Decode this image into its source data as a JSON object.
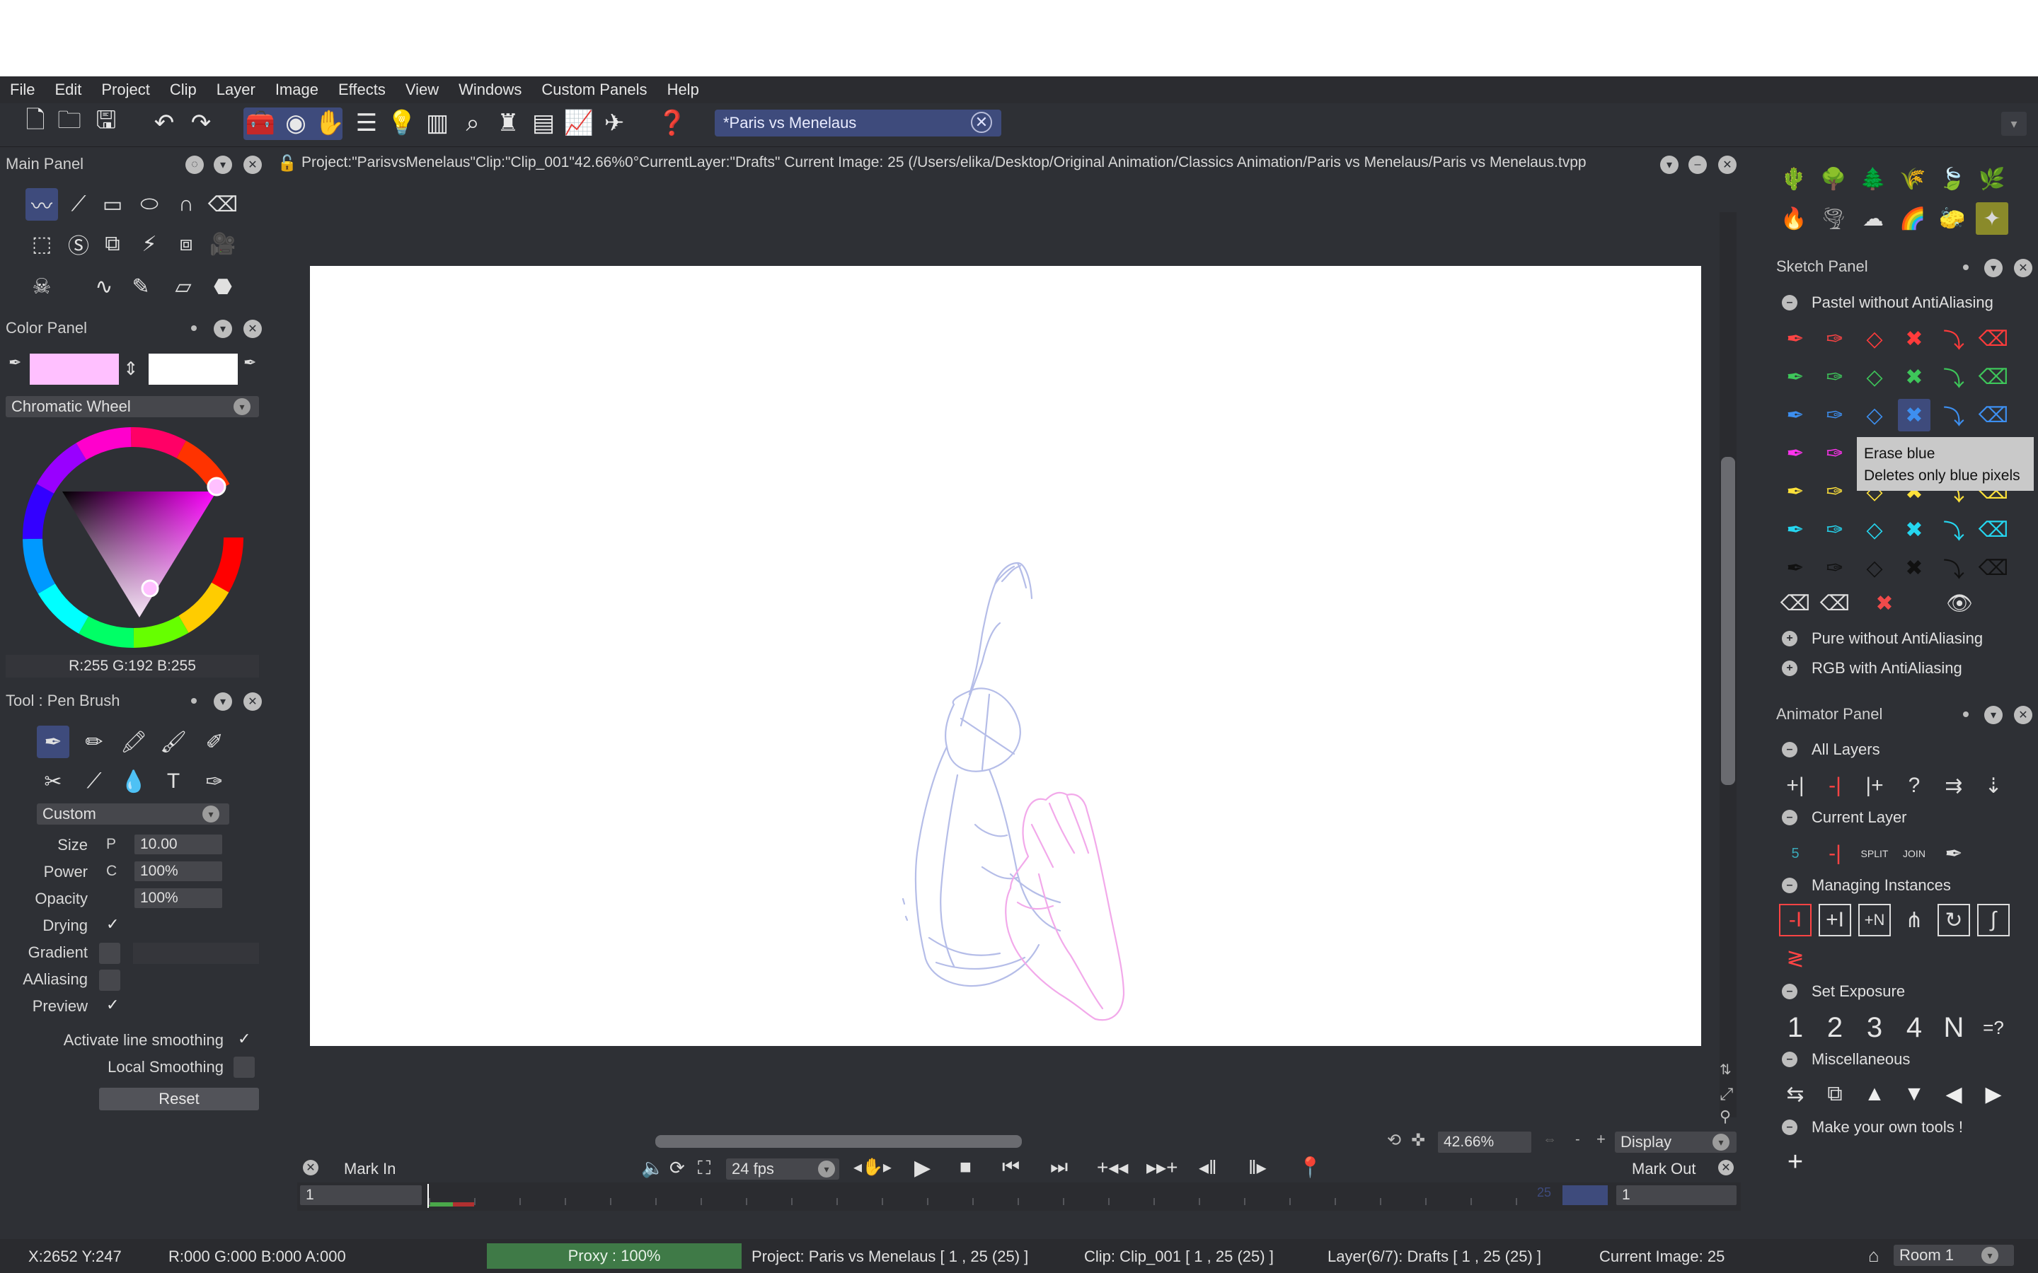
{
  "menu": [
    "File",
    "Edit",
    "Project",
    "Clip",
    "Layer",
    "Image",
    "Effects",
    "View",
    "Windows",
    "Custom Panels",
    "Help"
  ],
  "toolbar": {
    "doc_tab": "*Paris vs Menelaus",
    "close_glyph": "✕",
    "dropdown_glyph": "▾"
  },
  "main_panel": {
    "title": "Main Panel"
  },
  "path_text": "Project:\"ParisvsMenelaus\"Clip:\"Clip_001\"42.66%0°CurrentLayer:\"Drafts\" Current Image: 25 (/Users/elika/Desktop/Original Animation/Classics Animation/Paris vs Menelaus/Paris vs Menelaus.tvpp",
  "color_panel": {
    "title": "Color Panel",
    "mode": "Chromatic Wheel",
    "rgb_readout": "R:255 G:192 B:255",
    "primary_color": "#ffc0ff",
    "secondary_color": "#ffffff"
  },
  "tool_panel": {
    "title": "Tool : Pen Brush",
    "preset": "Custom",
    "size_label": "Size",
    "size_value": "10.00",
    "size_mode": "P",
    "power_label": "Power",
    "power_value": "100%",
    "power_mode": "C",
    "opacity_label": "Opacity",
    "opacity_value": "100%",
    "drying_label": "Drying",
    "drying_check": "✓",
    "gradient_label": "Gradient",
    "aaliasing_label": "AAliasing",
    "preview_label": "Preview",
    "preview_check": "✓",
    "smoothing_label": "Activate line smoothing",
    "smoothing_check": "✓",
    "local_smoothing_label": "Local Smoothing",
    "reset_label": "Reset"
  },
  "sketch_panel": {
    "title": "Sketch Panel",
    "group1": "Pastel without AntiAliasing",
    "group2": "Pure without AntiAliasing",
    "group3": "RGB with AntiAliasing",
    "tooltip_title": "Erase blue",
    "tooltip_body": "Deletes only blue pixels"
  },
  "animator_panel": {
    "title": "Animator Panel",
    "all_layers": "All Layers",
    "current_layer": "Current Layer",
    "managing_instances": "Managing Instances",
    "set_exposure": "Set Exposure",
    "exposure_buttons": [
      "1",
      "2",
      "3",
      "4",
      "N",
      "=?"
    ],
    "miscellaneous": "Miscellaneous",
    "make_tools": "Make your own tools !",
    "add_glyph": "+",
    "split_label": "SPLIT",
    "join_label": "JOIN",
    "five_label": "5"
  },
  "playback": {
    "mark_in": "Mark In",
    "fps": "24 fps",
    "mark_out": "Mark Out",
    "zoom": "42.66%",
    "display": "Display",
    "timeline_start": "1",
    "timeline_end": "1",
    "frame_marker": "25",
    "minus": "-",
    "plus": "+"
  },
  "status": {
    "coords": "X:2652  Y:247",
    "pixel": "R:000 G:000 B:000 A:000",
    "proxy": "Proxy : 100%",
    "project": "Project: Paris vs Menelaus [ 1 , 25  (25) ]",
    "clip": "Clip: Clip_001 [ 1 , 25  (25) ]",
    "layer": "Layer(6/7): Drafts [ 1 , 25  (25) ]",
    "current_image": "Current Image: 25",
    "room": "Room 1"
  },
  "colors": {
    "accent": "#3e4b7c",
    "panel_bg": "#2e3035",
    "proxy_green": "#3f7a47"
  }
}
